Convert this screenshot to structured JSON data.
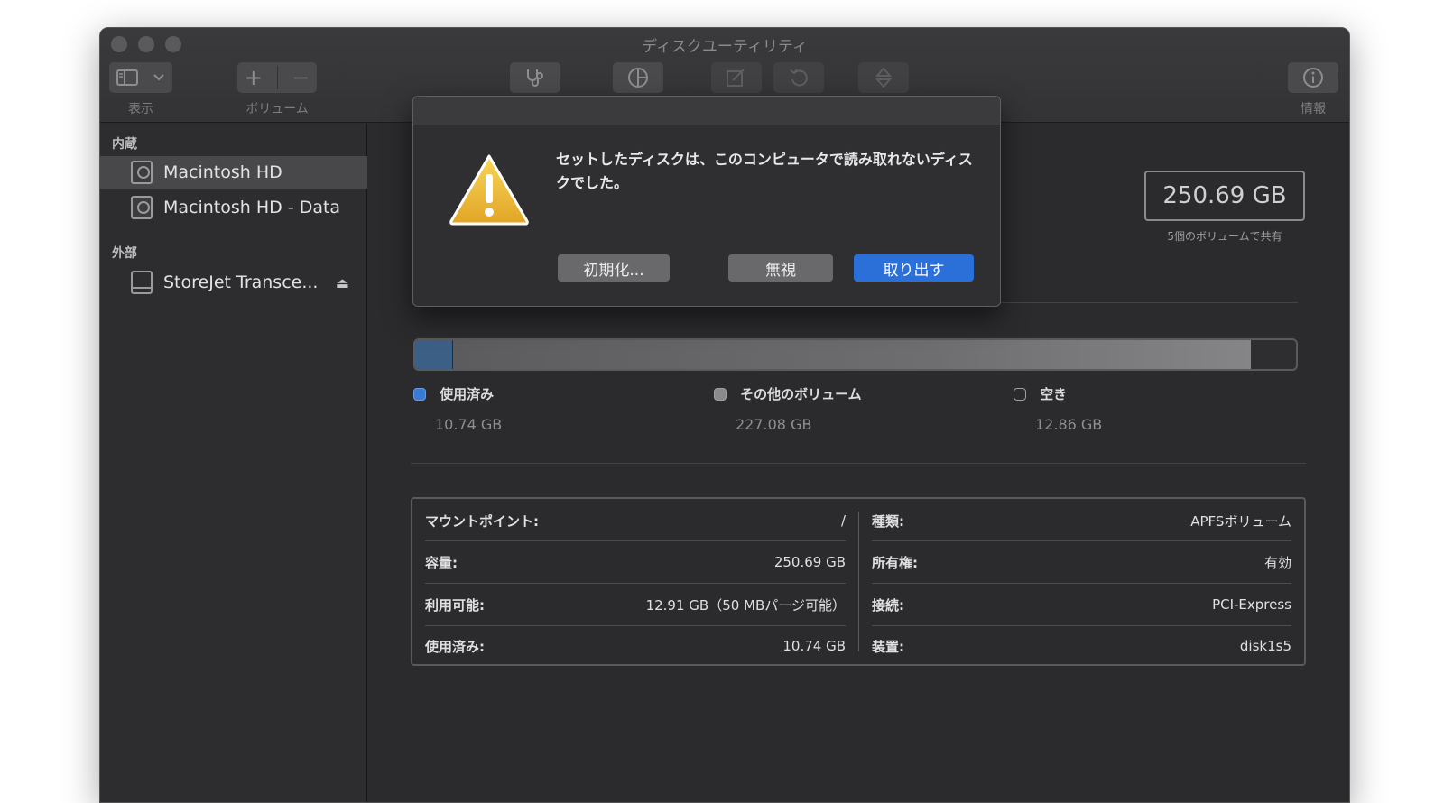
{
  "window": {
    "title": "ディスクユーティリティ"
  },
  "toolbar": {
    "view_label": "表示",
    "volume_label": "ボリューム",
    "info_label": "情報",
    "icons": [
      "sidebar-icon",
      "chevron-down-icon",
      "plus-icon",
      "minus-icon",
      "stethoscope-icon",
      "pie-chart-icon",
      "erase-icon",
      "restore-icon",
      "unmount-icon",
      "info-icon"
    ]
  },
  "sidebar": {
    "internal_header": "内蔵",
    "external_header": "外部",
    "internal_items": [
      {
        "label": "Macintosh HD",
        "selected": true
      },
      {
        "label": "Macintosh HD - Data",
        "selected": false
      }
    ],
    "external_items": [
      {
        "label": "StoreJet Transce..."
      }
    ]
  },
  "main": {
    "capacity": "250.69 GB",
    "capacity_sub": "5個のボリュームで共有",
    "usage": {
      "used_fraction": 0.043,
      "other_fraction": 0.906,
      "colors": {
        "used": "#3c5f86",
        "other": "#6e6e70",
        "free": "#2e2e30"
      },
      "legend": [
        {
          "label": "使用済み",
          "value": "10.74 GB",
          "color": "#3a7bd5"
        },
        {
          "label": "その他のボリューム",
          "value": "227.08 GB",
          "color": "#8a8a8c"
        },
        {
          "label": "空き",
          "value": "12.86 GB",
          "color": "#2b2b2d"
        }
      ]
    },
    "info_left": [
      {
        "key": "マウントポイント:",
        "value": "/"
      },
      {
        "key": "容量:",
        "value": "250.69 GB"
      },
      {
        "key": "利用可能:",
        "value": "12.91 GB（50 MBパージ可能）"
      },
      {
        "key": "使用済み:",
        "value": "10.74 GB"
      }
    ],
    "info_right": [
      {
        "key": "種類:",
        "value": "APFSボリューム"
      },
      {
        "key": "所有権:",
        "value": "有効"
      },
      {
        "key": "接続:",
        "value": "PCI-Express"
      },
      {
        "key": "装置:",
        "value": "disk1s5"
      }
    ]
  },
  "dialog": {
    "message": "セットしたディスクは、このコンピュータで読み取れないディスクでした。",
    "initialize_label": "初期化...",
    "ignore_label": "無視",
    "eject_label": "取り出す",
    "accent": "#2b6fd9"
  }
}
